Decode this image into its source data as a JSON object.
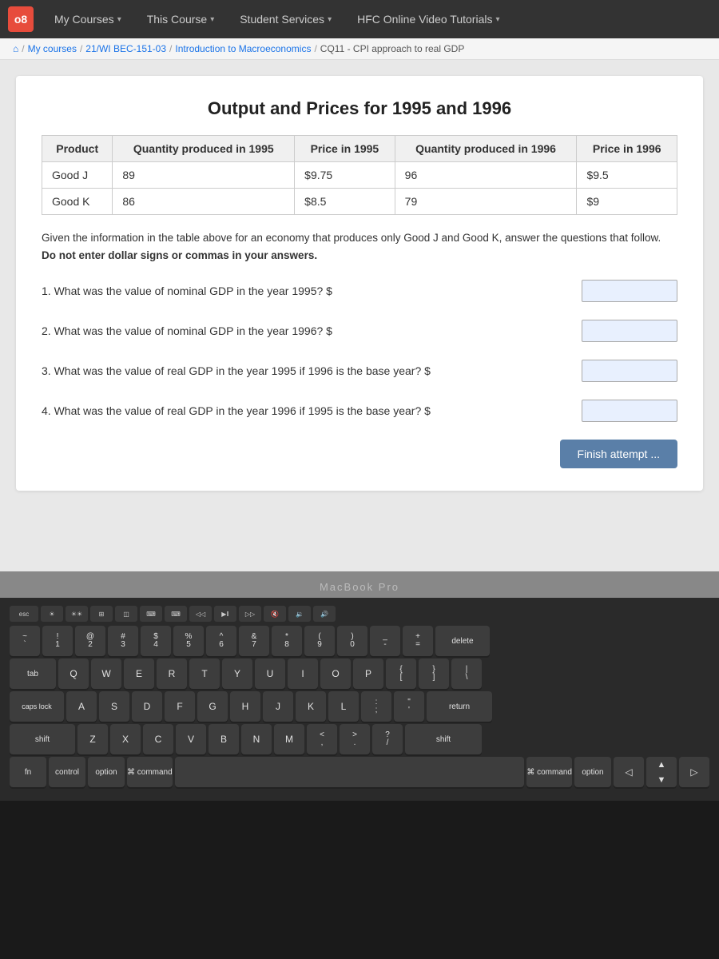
{
  "nav": {
    "logo_text": "o8",
    "items": [
      {
        "label": "My Courses",
        "has_dropdown": true
      },
      {
        "label": "This Course",
        "has_dropdown": true
      },
      {
        "label": "Student Services",
        "has_dropdown": true
      },
      {
        "label": "HFC Online Video Tutorials",
        "has_dropdown": true
      }
    ]
  },
  "breadcrumb": {
    "items": [
      {
        "label": "My courses",
        "link": true
      },
      {
        "label": "21/WI BEC-151-03",
        "link": true
      },
      {
        "label": "Introduction to Macroeconomics",
        "link": true
      },
      {
        "label": "CQ11 - CPI approach to real GDP",
        "link": false
      }
    ]
  },
  "card": {
    "title": "Output and Prices for 1995 and 1996",
    "table": {
      "headers": [
        "Product",
        "Quantity produced in 1995",
        "Price in 1995",
        "Quantity produced in 1996",
        "Price in 1996"
      ],
      "rows": [
        [
          "Good J",
          "89",
          "$9.75",
          "96",
          "$9.5"
        ],
        [
          "Good K",
          "86",
          "$8.5",
          "79",
          "$9"
        ]
      ]
    },
    "instruction": "Given the information in the table above for an economy that produces only Good J and Good K, answer the questions that follow.",
    "instruction_bold": "Do not enter dollar signs or commas in your answers.",
    "questions": [
      {
        "id": "q1",
        "text": "1. What was the value of nominal GDP in the year 1995? $",
        "value": ""
      },
      {
        "id": "q2",
        "text": "2. What was the value of nominal GDP in the year 1996? $",
        "value": ""
      },
      {
        "id": "q3",
        "text": "3. What was the value of real GDP in the year 1995 if 1996 is the base year? $",
        "value": ""
      },
      {
        "id": "q4",
        "text": "4. What was the value of real GDP in the year 1996 if 1995 is the base year? $",
        "value": ""
      }
    ],
    "finish_button": "Finish attempt ..."
  },
  "laptop": {
    "brand": "MacBook Pro"
  },
  "keyboard": {
    "fn_row": [
      "F1",
      "F2",
      "F3",
      "F4",
      "F5",
      "F6",
      "F7",
      "F8",
      "F9",
      "F10"
    ],
    "row1": [
      "!1",
      "@2",
      "#3",
      "$4",
      "%5",
      "^6",
      "&7",
      "*8",
      "(9",
      ")0",
      "-_",
      "=+"
    ],
    "row2_chars": [
      "Q",
      "W",
      "E",
      "R",
      "T",
      "Y",
      "U",
      "I",
      "O",
      "P",
      "[{",
      "]}"
    ],
    "row3_chars": [
      "A",
      "S",
      "D",
      "F",
      "G",
      "H",
      "J",
      "K",
      "L",
      ";:",
      "'\""
    ],
    "row4_chars": [
      "Z",
      "X",
      "C",
      "V",
      "B",
      "N",
      "M",
      ",<",
      ".>",
      "/?"
    ]
  }
}
